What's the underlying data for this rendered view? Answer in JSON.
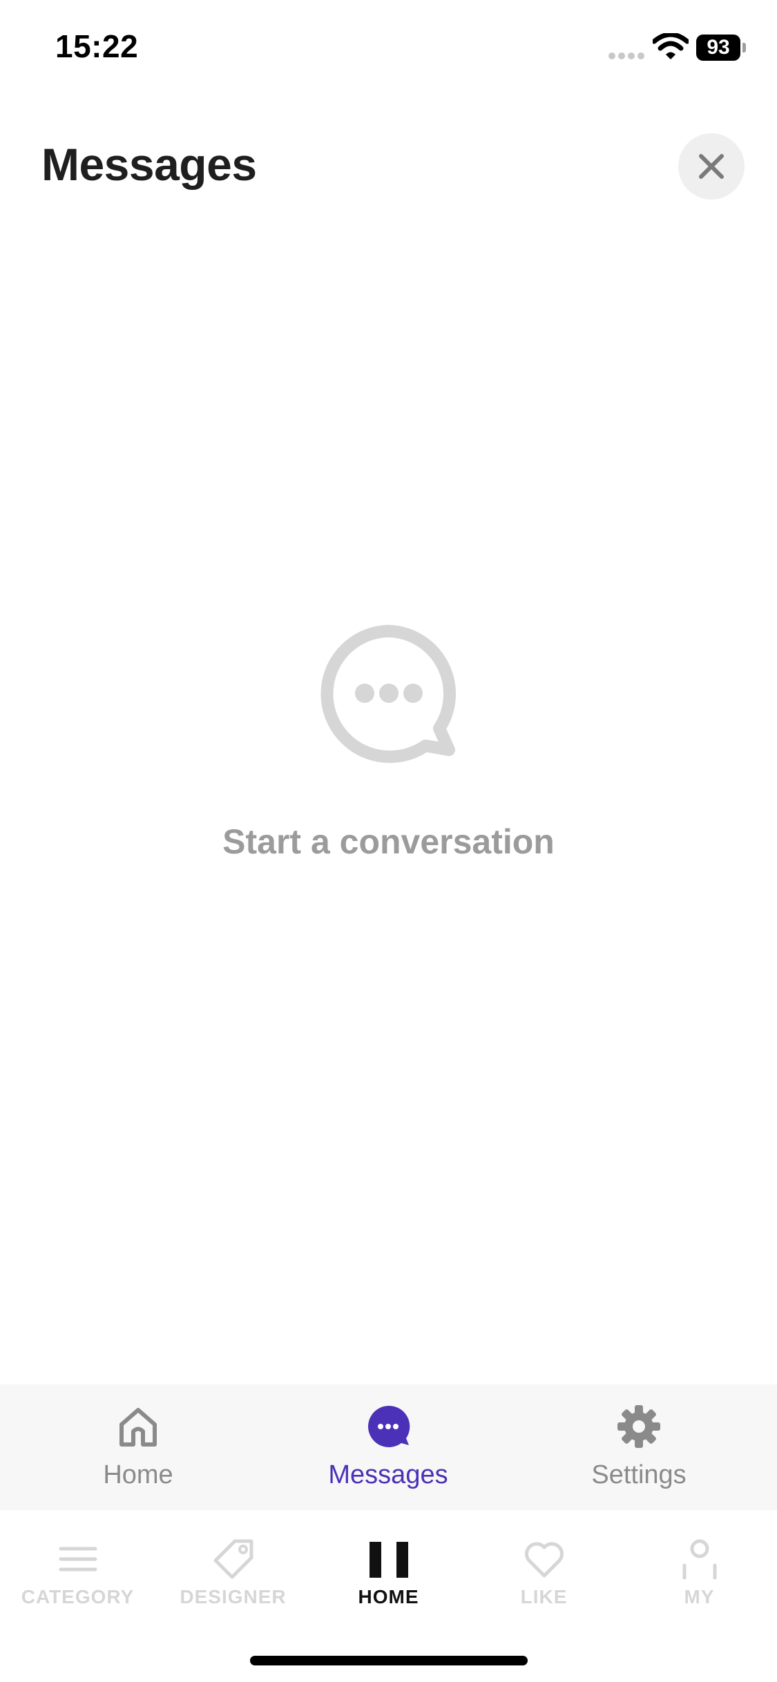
{
  "status_bar": {
    "time": "15:22",
    "battery": "93"
  },
  "header": {
    "title": "Messages"
  },
  "empty_state": {
    "icon": "chat-bubble-icon",
    "text": "Start a conversation"
  },
  "inner_tabs": [
    {
      "label": "Home",
      "icon": "house-icon",
      "active": false
    },
    {
      "label": "Messages",
      "icon": "chat-bubble-icon",
      "active": true
    },
    {
      "label": "Settings",
      "icon": "gear-icon",
      "active": false
    }
  ],
  "bottom_nav": [
    {
      "label": "CATEGORY",
      "icon": "menu-lines-icon",
      "active": false
    },
    {
      "label": "DESIGNER",
      "icon": "tag-icon",
      "active": false
    },
    {
      "label": "HOME",
      "icon": "pause-bars-icon",
      "active": true
    },
    {
      "label": "LIKE",
      "icon": "heart-icon",
      "active": false
    },
    {
      "label": "MY",
      "icon": "person-icon",
      "active": false
    }
  ],
  "colors": {
    "accent": "#4b31b8",
    "inactive_tab": "#8a8a8a",
    "inactive_nav": "#d6d6d6",
    "empty_state": "#9b9b9b"
  }
}
